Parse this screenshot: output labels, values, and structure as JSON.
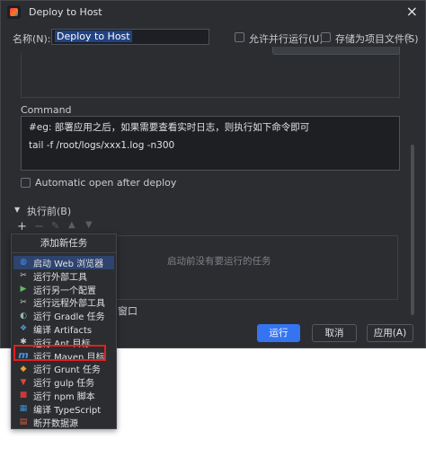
{
  "window": {
    "title": "Deploy to Host"
  },
  "form": {
    "name_label": "名称(N):",
    "name_value": "Deploy to Host",
    "parallel_label": "允许并行运行(U)",
    "save_label": "存储为项目文件(S)"
  },
  "command": {
    "label": "Command",
    "line1": "#eg: 部署应用之后，如果需要查看实时日志，则执行如下命令即可",
    "line2": "tail -f /root/logs/xxx1.log -n300"
  },
  "auto_open": {
    "label": "Automatic open after deploy"
  },
  "before_launch": {
    "label": "执行前(B)",
    "empty_text": "启动前没有要运行的任务",
    "window_suffix": "窗口"
  },
  "buttons": {
    "run": "运行",
    "cancel": "取消",
    "apply": "应用(A)"
  },
  "popup": {
    "header": "添加新任务",
    "items": [
      {
        "label": "启动 Web 浏览器",
        "icon": "globe-icon",
        "color": "#4a8fe7"
      },
      {
        "label": "运行外部工具",
        "icon": "tool-icon",
        "color": "#c9ccd1"
      },
      {
        "label": "运行另一个配置",
        "icon": "play-icon",
        "color": "#5fb865"
      },
      {
        "label": "运行远程外部工具",
        "icon": "remote-tool-icon",
        "color": "#c9ccd1"
      },
      {
        "label": "运行 Gradle 任务",
        "icon": "gradle-icon",
        "color": "#8fb8b0"
      },
      {
        "label": "编译 Artifacts",
        "icon": "artifact-icon",
        "color": "#4a9ee0"
      },
      {
        "label": "运行 Ant 目标",
        "icon": "ant-icon",
        "color": "#c9ccd1"
      },
      {
        "label": "运行 Maven 目标",
        "icon": "maven-icon",
        "color": "#4a8fe7"
      },
      {
        "label": "运行 Grunt 任务",
        "icon": "grunt-icon",
        "color": "#e6a235"
      },
      {
        "label": "运行 gulp 任务",
        "icon": "gulp-icon",
        "color": "#e0463c"
      },
      {
        "label": "运行 npm 脚本",
        "icon": "npm-icon",
        "color": "#cb3837"
      },
      {
        "label": "编译 TypeScript",
        "icon": "typescript-icon",
        "color": "#3d8fd6"
      },
      {
        "label": "断开数据源",
        "icon": "database-disconnect-icon",
        "color": "#e05a3a"
      }
    ],
    "selected_index": 0,
    "highlight_index": 7
  }
}
